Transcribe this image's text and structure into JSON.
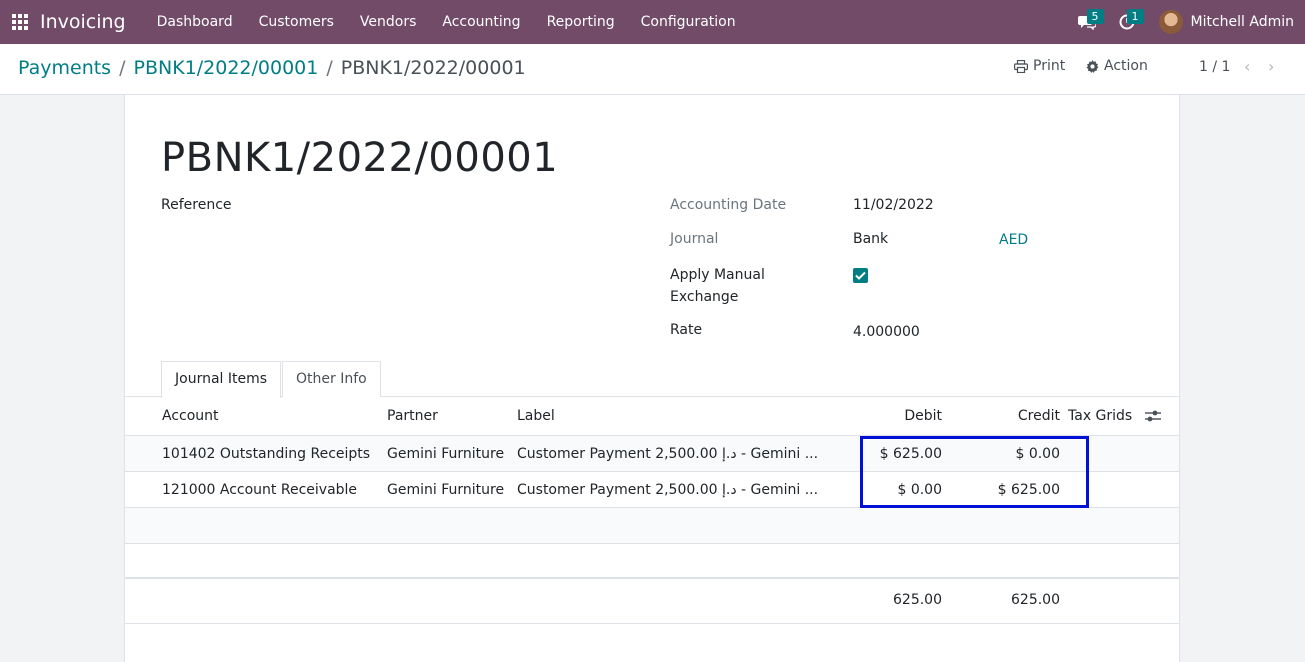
{
  "navbar": {
    "app_name": "Invoicing",
    "menu": [
      "Dashboard",
      "Customers",
      "Vendors",
      "Accounting",
      "Reporting",
      "Configuration"
    ],
    "messages_count": "5",
    "activities_count": "1",
    "user_name": "Mitchell Admin",
    "color": "#714b67"
  },
  "breadcrumb": {
    "root": "Payments",
    "parent": "PBNK1/2022/00001",
    "current": "PBNK1/2022/00001"
  },
  "control": {
    "print_label": "Print",
    "action_label": "Action",
    "pager": "1 / 1"
  },
  "form": {
    "title": "PBNK1/2022/00001",
    "reference_label": "Reference",
    "accounting_date_label": "Accounting Date",
    "accounting_date": "11/02/2022",
    "journal_label": "Journal",
    "journal": "Bank",
    "currency": "AED",
    "apply_manual_label_1": "Apply Manual",
    "apply_manual_label_2": "Exchange",
    "apply_manual_checked": true,
    "rate_label": "Rate",
    "rate": "4.000000"
  },
  "tabs": [
    "Journal Items",
    "Other Info"
  ],
  "table": {
    "headers": {
      "account": "Account",
      "partner": "Partner",
      "label": "Label",
      "debit": "Debit",
      "credit": "Credit",
      "tax_grids": "Tax Grids"
    },
    "rows": [
      {
        "account": "101402 Outstanding Receipts",
        "partner": "Gemini Furniture",
        "label": "Customer Payment 2,500.00 د.إ - Gemini ...",
        "debit": "$ 625.00",
        "credit": "$ 0.00"
      },
      {
        "account": "121000 Account Receivable",
        "partner": "Gemini Furniture",
        "label": "Customer Payment 2,500.00 د.إ - Gemini ...",
        "debit": "$ 0.00",
        "credit": "$ 625.00"
      }
    ],
    "totals": {
      "debit": "625.00",
      "credit": "625.00"
    }
  },
  "accent_color": "#017e84"
}
